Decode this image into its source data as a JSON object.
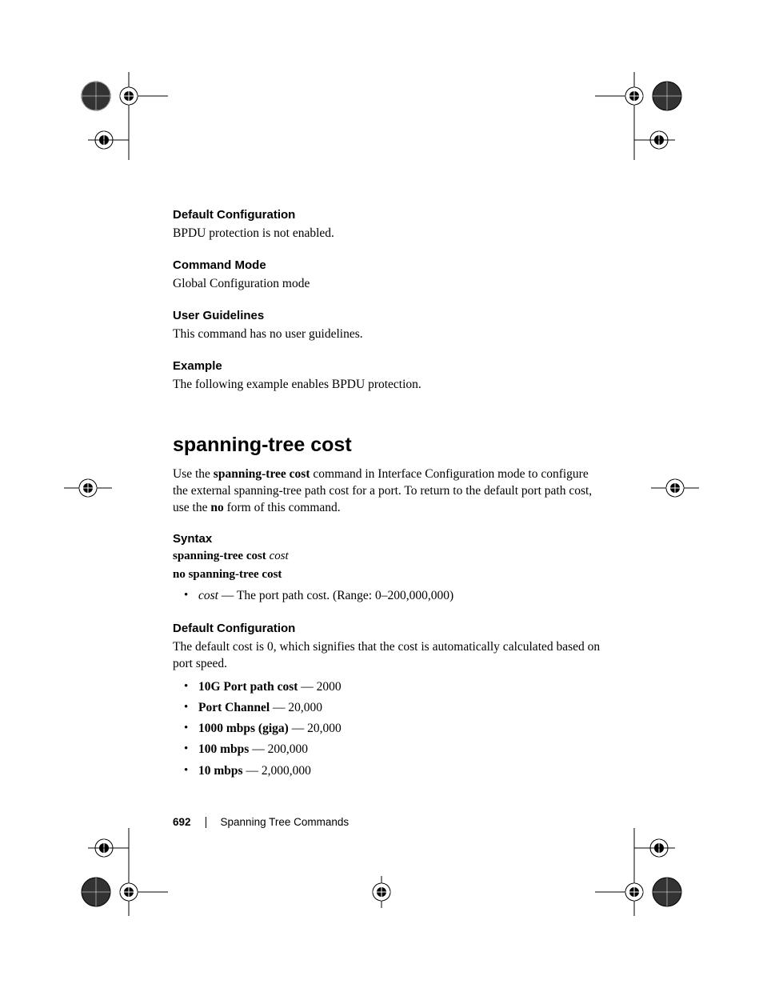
{
  "sections": {
    "defaultConfig1": {
      "heading": "Default Configuration",
      "text": "BPDU protection is not enabled."
    },
    "commandMode": {
      "heading": "Command Mode",
      "text": "Global Configuration mode"
    },
    "userGuidelines": {
      "heading": "User Guidelines",
      "text": "This command has no user guidelines."
    },
    "example": {
      "heading": "Example",
      "text": "The following example enables BPDU protection."
    }
  },
  "mainCommand": {
    "title": "spanning-tree cost",
    "desc_pre": "Use the ",
    "desc_bold1": "spanning-tree cost",
    "desc_mid": " command in Interface Configuration mode to configure the external spanning-tree path cost for a port. To return to the default port path cost, use the ",
    "desc_bold2": "no",
    "desc_post": " form of this command."
  },
  "syntax": {
    "heading": "Syntax",
    "line1_bold": "spanning-tree cost ",
    "line1_italic": "cost",
    "line2": "no spanning-tree cost",
    "bullet_italic": "cost ",
    "bullet_text": "— The port path cost. (Range: 0–200,000,000)"
  },
  "defaultConfig2": {
    "heading": "Default Configuration",
    "text": "The default cost is 0, which signifies that the cost is automatically calculated based on port speed.",
    "items": [
      {
        "bold": "10G Port path cost",
        "rest": " — 2000"
      },
      {
        "bold": "Port Channel",
        "rest": " — 20,000"
      },
      {
        "bold": "1000 mbps (giga)",
        "rest": " — 20,000"
      },
      {
        "bold": "100 mbps",
        "rest": " — 200,000"
      },
      {
        "bold": "10 mbps",
        "rest": " — 2,000,000"
      }
    ]
  },
  "footer": {
    "pageNum": "692",
    "chapter": "Spanning Tree Commands"
  }
}
